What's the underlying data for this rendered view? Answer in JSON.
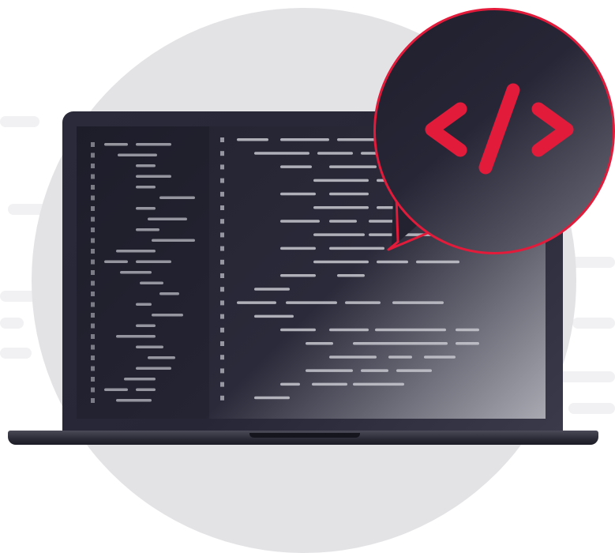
{
  "illustration": {
    "subject": "laptop",
    "badge_icon": "code-icon",
    "colors": {
      "accent": "#e31b3b",
      "laptop_body": "#262636",
      "screen": "#22222f",
      "code_line": "#c8c8d0",
      "background_circle": "#e3e3e6",
      "background_streak": "#f1f1f3"
    }
  }
}
